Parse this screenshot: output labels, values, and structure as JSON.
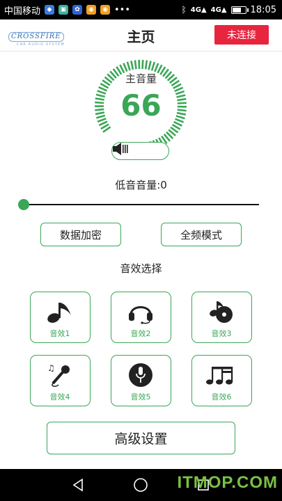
{
  "status_bar": {
    "carrier": "中国移动",
    "network": "4G",
    "network2": "4G",
    "time": "18:05",
    "battery_level": 0.75
  },
  "header": {
    "brand_name": "CROSSFIRE",
    "brand_tagline": "CAR AUDIO SYSTEM",
    "title": "主页",
    "connect_label": "未连接"
  },
  "volume": {
    "label": "主音量",
    "value": "66",
    "max": 100,
    "level": 0.66
  },
  "bass": {
    "label": "低音音量:0",
    "value": 0
  },
  "buttons": {
    "encrypt_label": "数据加密",
    "fullband_label": "全频模式",
    "advanced_label": "高级设置"
  },
  "effects": {
    "title": "音效选择",
    "items": [
      {
        "label": "音效1",
        "icon": "music-note-icon"
      },
      {
        "label": "音效2",
        "icon": "headphones-icon"
      },
      {
        "label": "音效3",
        "icon": "music-disc-icon"
      },
      {
        "label": "音效4",
        "icon": "microphone-icon"
      },
      {
        "label": "音效5",
        "icon": "vinyl-mic-icon"
      },
      {
        "label": "音效6",
        "icon": "sixteenth-notes-icon"
      }
    ]
  },
  "watermark": "ITMOP.COM",
  "colors": {
    "accent": "#3aa657",
    "connect": "#e8253f",
    "gauge_idle": "#a8d6b3"
  }
}
